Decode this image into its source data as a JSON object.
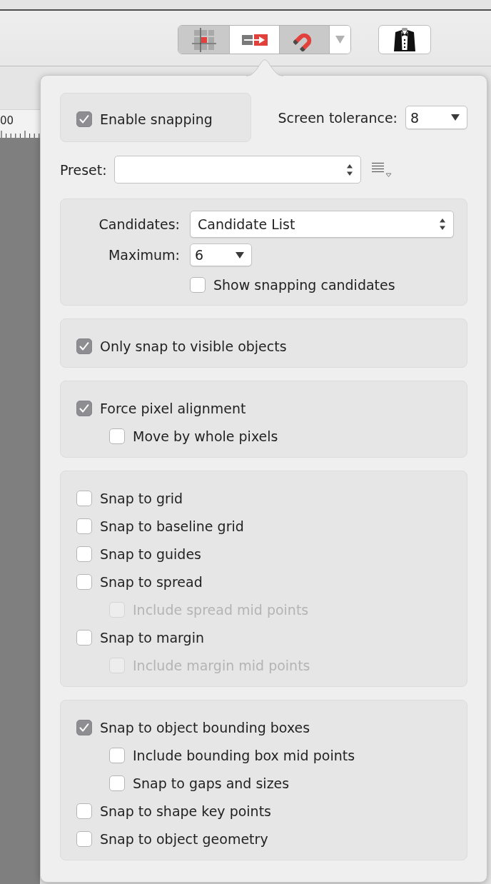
{
  "toolbar": {
    "segments": [
      {
        "kind": "grid",
        "selected": true
      },
      {
        "kind": "snap",
        "selected": false
      },
      {
        "kind": "magnet",
        "selected": true
      },
      {
        "kind": "menu",
        "selected": false
      }
    ]
  },
  "ruler": {
    "label": "00"
  },
  "popover": {
    "enable_snapping": {
      "label": "Enable snapping",
      "checked": true
    },
    "screen_tolerance": {
      "label": "Screen tolerance:",
      "value": "8"
    },
    "preset": {
      "label": "Preset:"
    },
    "candidates": {
      "label": "Candidates:",
      "value": "Candidate List"
    },
    "maximum": {
      "label": "Maximum:",
      "value": "6"
    },
    "show_candidates": {
      "label": "Show snapping candidates",
      "checked": false
    },
    "sections": [
      {
        "options": [
          {
            "label": "Only snap to visible objects",
            "checked": true,
            "disabled": false
          }
        ]
      },
      {
        "options": [
          {
            "label": "Force pixel alignment",
            "checked": true,
            "disabled": false,
            "children": [
              {
                "label": "Move by whole pixels",
                "checked": false,
                "disabled": false
              }
            ]
          }
        ]
      },
      {
        "options": [
          {
            "label": "Snap to grid",
            "checked": false,
            "disabled": false
          },
          {
            "label": "Snap to baseline grid",
            "checked": false,
            "disabled": false
          },
          {
            "label": "Snap to guides",
            "checked": false,
            "disabled": false
          },
          {
            "label": "Snap to spread",
            "checked": false,
            "disabled": false,
            "children": [
              {
                "label": "Include spread mid points",
                "checked": false,
                "disabled": true
              }
            ]
          },
          {
            "label": "Snap to margin",
            "checked": false,
            "disabled": false,
            "children": [
              {
                "label": "Include margin mid points",
                "checked": false,
                "disabled": true
              }
            ]
          }
        ]
      },
      {
        "options": [
          {
            "label": "Snap to object bounding boxes",
            "checked": true,
            "disabled": false,
            "children": [
              {
                "label": "Include bounding box mid points",
                "checked": false,
                "disabled": false
              },
              {
                "label": "Snap to gaps and sizes",
                "checked": false,
                "disabled": false
              }
            ]
          },
          {
            "label": "Snap to shape key points",
            "checked": false,
            "disabled": false
          },
          {
            "label": "Snap to object geometry",
            "checked": false,
            "disabled": false
          }
        ]
      }
    ]
  }
}
